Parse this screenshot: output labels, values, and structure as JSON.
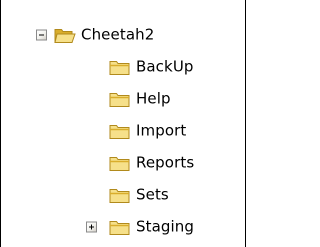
{
  "tree": {
    "root": {
      "label": "Cheetah2",
      "expander": "minus",
      "icon": "folder-open-icon"
    },
    "children": [
      {
        "label": "BackUp",
        "icon": "folder-icon",
        "expander": null
      },
      {
        "label": "Help",
        "icon": "folder-icon",
        "expander": null
      },
      {
        "label": "Import",
        "icon": "folder-icon",
        "expander": null
      },
      {
        "label": "Reports",
        "icon": "folder-icon",
        "expander": null
      },
      {
        "label": "Sets",
        "icon": "folder-icon",
        "expander": null
      },
      {
        "label": "Staging",
        "icon": "folder-icon",
        "expander": "plus"
      }
    ]
  },
  "colors": {
    "folder_fill": "#f6e08a",
    "folder_dark": "#d9ad2c",
    "folder_outline": "#b18a1c",
    "expander_border": "#8a8a8a"
  }
}
